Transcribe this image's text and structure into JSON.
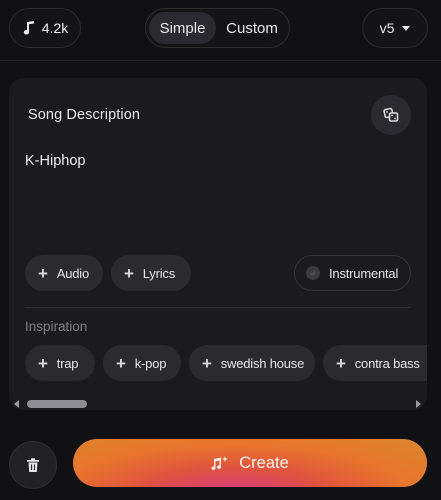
{
  "topbar": {
    "credits": "4.2k",
    "modes": [
      "Simple",
      "Custom"
    ],
    "active_mode": "Simple",
    "model": "v5"
  },
  "card": {
    "description_label": "Song Description",
    "description_value": "K-Hiphop",
    "actions": [
      "Audio",
      "Lyrics"
    ],
    "instrumental_label": "Instrumental",
    "inspiration_label": "Inspiration",
    "inspiration_tags": [
      "trap",
      "k-pop",
      "swedish house",
      "contra bass"
    ]
  },
  "footer": {
    "create_label": "Create"
  },
  "colors": {
    "background": "#111114",
    "card": "#1b1b1f",
    "chip": "#2a2a2f",
    "create_gradient_start": "#e8762c",
    "create_gradient_end": "#d63a8f"
  },
  "icons": {
    "credits": "music-note-icon",
    "model_select": "chevron-down-icon",
    "random": "dice-icon",
    "add": "plus-icon",
    "instrumental": "check-circle-icon",
    "delete": "trash-icon",
    "create": "music-sparkle-icon"
  }
}
